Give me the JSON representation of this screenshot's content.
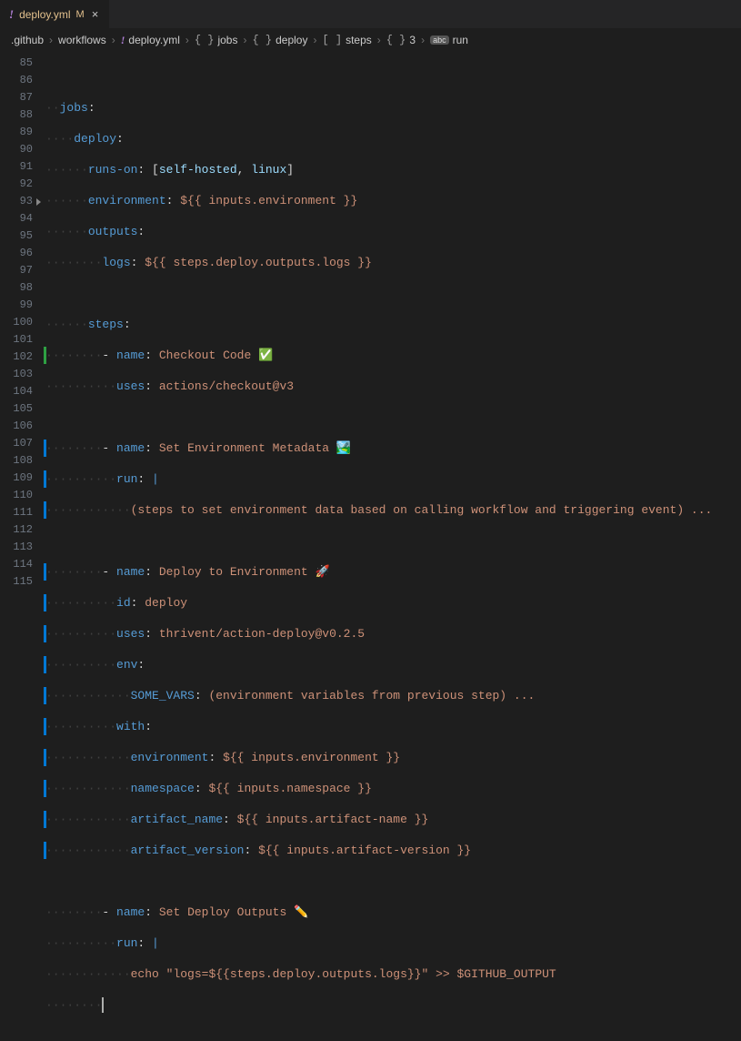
{
  "tab": {
    "icon": "!",
    "filename": "deploy.yml",
    "modified_badge": "M",
    "close": "×"
  },
  "breadcrumbs": {
    "seg0": ".github",
    "seg1": "workflows",
    "seg2_icon": "!",
    "seg2": "deploy.yml",
    "seg3_icon": "{ }",
    "seg3": "jobs",
    "seg4_icon": "{ }",
    "seg4": "deploy",
    "seg5_icon": "[ ]",
    "seg5": "steps",
    "seg6_icon": "{ }",
    "seg6": "3",
    "seg7_icon": "abc",
    "seg7": "run"
  },
  "line_numbers": [
    "85",
    "86",
    "87",
    "88",
    "89",
    "90",
    "91",
    "92",
    "93",
    "94",
    "95",
    "96",
    "97",
    "98",
    "99",
    "100",
    "101",
    "102",
    "103",
    "104",
    "105",
    "106",
    "107",
    "108",
    "109",
    "110",
    "111",
    "112",
    "113",
    "114",
    "115"
  ],
  "code": {
    "l86_k1": "jobs",
    "l86_c": ":",
    "l87_k1": "deploy",
    "l87_c": ":",
    "l88_k1": "runs-on",
    "l88_c": ": ",
    "l88_b1": "[",
    "l88_v1": "self-hosted",
    "l88_cm": ", ",
    "l88_v2": "linux",
    "l88_b2": "]",
    "l89_k1": "environment",
    "l89_c": ": ",
    "l89_v": "${{ inputs.environment }}",
    "l90_k1": "outputs",
    "l90_c": ":",
    "l91_k1": "logs",
    "l91_c": ": ",
    "l91_v": "${{ steps.deploy.outputs.logs }}",
    "l93_k1": "steps",
    "l93_c": ":",
    "l94_d": "- ",
    "l94_k1": "name",
    "l94_c": ": ",
    "l94_v": "Checkout Code ✅",
    "l95_k1": "uses",
    "l95_c": ": ",
    "l95_v": "actions/checkout@v3",
    "l97_d": "- ",
    "l97_k1": "name",
    "l97_c": ": ",
    "l97_v": "Set Environment Metadata 🏞️",
    "l98_k1": "run",
    "l98_c": ": ",
    "l98_v": "|",
    "l99_v": "(steps to set environment data based on calling workflow and triggering event) ...",
    "l101_d": "- ",
    "l101_k1": "name",
    "l101_c": ": ",
    "l101_v": "Deploy to Environment 🚀",
    "l102_k1": "id",
    "l102_c": ": ",
    "l102_v": "deploy",
    "l103_k1": "uses",
    "l103_c": ": ",
    "l103_v": "thrivent/action-deploy@v0.2.5",
    "l104_k1": "env",
    "l104_c": ":",
    "l105_k1": "SOME_VARS",
    "l105_c": ": ",
    "l105_v": "(environment variables from previous step) ...",
    "l106_k1": "with",
    "l106_c": ":",
    "l107_k1": "environment",
    "l107_c": ": ",
    "l107_v": "${{ inputs.environment }}",
    "l108_k1": "namespace",
    "l108_c": ": ",
    "l108_v": "${{ inputs.namespace }}",
    "l109_k1": "artifact_name",
    "l109_c": ": ",
    "l109_v": "${{ inputs.artifact-name }}",
    "l110_k1": "artifact_version",
    "l110_c": ": ",
    "l110_v": "${{ inputs.artifact-version }}",
    "l112_d": "- ",
    "l112_k1": "name",
    "l112_c": ": ",
    "l112_v": "Set Deploy Outputs ✏️",
    "l113_k1": "run",
    "l113_c": ": ",
    "l113_v": "|",
    "l114_a": "echo ",
    "l114_b": "\"logs=${{steps.deploy.outputs.logs}}\"",
    "l114_c": " >> $GITHUB_OUTPUT"
  }
}
